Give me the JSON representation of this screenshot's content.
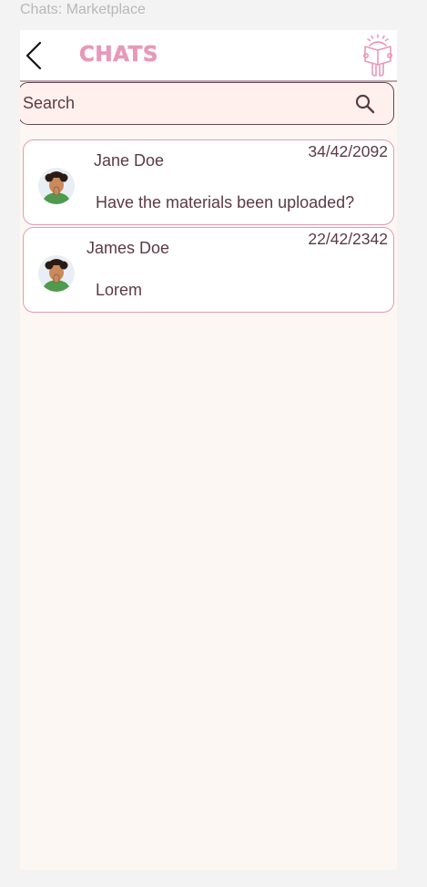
{
  "frame_label": "Chats: Marketplace",
  "header": {
    "title": "CHATS",
    "back_icon": "chevron-left-icon",
    "mascot_icon": "mascot-reading-icon"
  },
  "search": {
    "placeholder": "Search",
    "icon": "search-icon"
  },
  "colors": {
    "title": "#e79ab8",
    "text": "#5b3a45",
    "card_border": "#df9cb4",
    "search_bg": "#fff0ee",
    "page_bg": "#fdf7f4"
  },
  "chats": [
    {
      "name": "Jane Doe",
      "date": "34/42/2092",
      "message": "Have the materials been uploaded?"
    },
    {
      "name": "James Doe",
      "date": "22/42/2342",
      "message": "Lorem"
    }
  ]
}
